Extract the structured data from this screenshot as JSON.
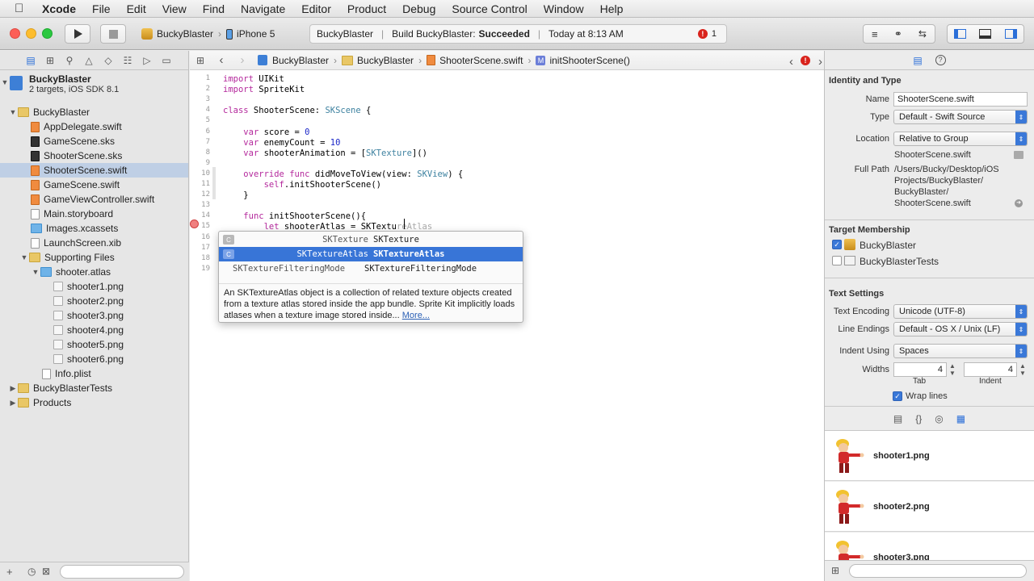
{
  "menubar": {
    "app": "Xcode",
    "items": [
      "File",
      "Edit",
      "View",
      "Find",
      "Navigate",
      "Editor",
      "Product",
      "Debug",
      "Source Control",
      "Window",
      "Help"
    ]
  },
  "toolbar": {
    "scheme": "BuckyBlaster",
    "device": "iPhone 5",
    "activity": {
      "project": "BuckyBlaster",
      "build_prefix": "Build BuckyBlaster:",
      "build_status": "Succeeded",
      "time": "Today at 8:13 AM",
      "error_count": "1"
    }
  },
  "navigator": {
    "project": {
      "name": "BuckyBlaster",
      "subtitle": "2 targets, iOS SDK 8.1"
    },
    "items": [
      {
        "label": "BuckyBlaster",
        "kind": "folder",
        "indent": 1,
        "open": true
      },
      {
        "label": "AppDelegate.swift",
        "kind": "swift",
        "indent": 2
      },
      {
        "label": "GameScene.sks",
        "kind": "sks",
        "indent": 2
      },
      {
        "label": "ShooterScene.sks",
        "kind": "sks",
        "indent": 2
      },
      {
        "label": "ShooterScene.swift",
        "kind": "swift",
        "indent": 2,
        "selected": true
      },
      {
        "label": "GameScene.swift",
        "kind": "swift",
        "indent": 2
      },
      {
        "label": "GameViewController.swift",
        "kind": "swift",
        "indent": 2
      },
      {
        "label": "Main.storyboard",
        "kind": "file",
        "indent": 2
      },
      {
        "label": "Images.xcassets",
        "kind": "bfolder",
        "indent": 2
      },
      {
        "label": "LaunchScreen.xib",
        "kind": "file",
        "indent": 2
      },
      {
        "label": "Supporting Files",
        "kind": "folder",
        "indent": 2,
        "open": true
      },
      {
        "label": "shooter.atlas",
        "kind": "bfolder",
        "indent": 3,
        "open": true
      },
      {
        "label": "shooter1.png",
        "kind": "png",
        "indent": 4
      },
      {
        "label": "shooter2.png",
        "kind": "png",
        "indent": 4
      },
      {
        "label": "shooter3.png",
        "kind": "png",
        "indent": 4
      },
      {
        "label": "shooter4.png",
        "kind": "png",
        "indent": 4
      },
      {
        "label": "shooter5.png",
        "kind": "png",
        "indent": 4
      },
      {
        "label": "shooter6.png",
        "kind": "png",
        "indent": 4
      },
      {
        "label": "Info.plist",
        "kind": "file",
        "indent": 3
      },
      {
        "label": "BuckyBlasterTests",
        "kind": "folder",
        "indent": 1,
        "open": false
      },
      {
        "label": "Products",
        "kind": "folder",
        "indent": 1,
        "open": false
      }
    ]
  },
  "jumpbar": [
    "BuckyBlaster",
    "BuckyBlaster",
    "ShooterScene.swift",
    "initShooterScene()"
  ],
  "code": {
    "line_numbers": [
      "1",
      "2",
      "3",
      "4",
      "5",
      "6",
      "7",
      "8",
      "9",
      "10",
      "11",
      "12",
      "13",
      "14",
      "15",
      "16",
      "17",
      "18",
      "19"
    ],
    "lines": [
      [
        {
          "t": "import",
          "c": "kw"
        },
        {
          "t": " UIKit"
        }
      ],
      [
        {
          "t": "import",
          "c": "kw"
        },
        {
          "t": " SpriteKit"
        }
      ],
      [],
      [
        {
          "t": "class",
          "c": "kw"
        },
        {
          "t": " ShooterScene: "
        },
        {
          "t": "SKScene",
          "c": "ty"
        },
        {
          "t": " {"
        }
      ],
      [],
      [
        {
          "t": "    "
        },
        {
          "t": "var",
          "c": "kw"
        },
        {
          "t": " score = "
        },
        {
          "t": "0",
          "c": "nu"
        }
      ],
      [
        {
          "t": "    "
        },
        {
          "t": "var",
          "c": "kw"
        },
        {
          "t": " enemyCount = "
        },
        {
          "t": "10",
          "c": "nu"
        }
      ],
      [
        {
          "t": "    "
        },
        {
          "t": "var",
          "c": "kw"
        },
        {
          "t": " shooterAnimation = ["
        },
        {
          "t": "SKTexture",
          "c": "ty"
        },
        {
          "t": "]()"
        }
      ],
      [],
      [
        {
          "t": "    "
        },
        {
          "t": "override",
          "c": "kw"
        },
        {
          "t": " "
        },
        {
          "t": "func",
          "c": "kw"
        },
        {
          "t": " didMoveToView(view: "
        },
        {
          "t": "SKView",
          "c": "ty"
        },
        {
          "t": ") {"
        }
      ],
      [
        {
          "t": "        "
        },
        {
          "t": "self",
          "c": "kw"
        },
        {
          "t": ".initShooterScene()"
        }
      ],
      [
        {
          "t": "    }"
        }
      ],
      [],
      [
        {
          "t": "    "
        },
        {
          "t": "func",
          "c": "kw"
        },
        {
          "t": " initShooterScene(){"
        }
      ],
      [
        {
          "t": "        "
        },
        {
          "t": "let",
          "c": "kw"
        },
        {
          "t": " shooterAtlas = SKTextu"
        },
        {
          "t": "reAtlas",
          "c": "ghost"
        }
      ],
      [],
      [],
      [],
      []
    ]
  },
  "autocomplete": {
    "suggestions": [
      {
        "type": "SKTexture",
        "name": "SKTexture",
        "kind": "C"
      },
      {
        "type": "SKTextureAtlas",
        "name": "SKTextureAtlas",
        "kind": "C",
        "active": true
      },
      {
        "type": "SKTextureFilteringMode",
        "name": "SKTextureFilteringMode",
        "kind": ""
      }
    ],
    "doc": "An SKTextureAtlas object is a collection of related texture objects created from a texture atlas stored inside the app bundle. Sprite Kit implicitly loads atlases when a texture image stored inside...",
    "more": "More..."
  },
  "inspector": {
    "identity": {
      "title": "Identity and Type",
      "name_label": "Name",
      "name": "ShooterScene.swift",
      "type_label": "Type",
      "type": "Default - Swift Source",
      "location_label": "Location",
      "location": "Relative to Group",
      "location_file": "ShooterScene.swift",
      "fullpath_label": "Full Path",
      "fullpath": [
        "/Users/Bucky/Desktop/iOS",
        "Projects/BuckyBlaster/",
        "BuckyBlaster/",
        "ShooterScene.swift"
      ]
    },
    "membership": {
      "title": "Target Membership",
      "targets": [
        {
          "name": "BuckyBlaster",
          "checked": true
        },
        {
          "name": "BuckyBlasterTests",
          "checked": false
        }
      ]
    },
    "text": {
      "title": "Text Settings",
      "encoding_label": "Text Encoding",
      "encoding": "Unicode (UTF-8)",
      "endings_label": "Line Endings",
      "endings": "Default - OS X / Unix (LF)",
      "indent_label": "Indent Using",
      "indent": "Spaces",
      "widths_label": "Widths",
      "tab_width": "4",
      "indent_width": "4",
      "tab_label": "Tab",
      "indent_sub_label": "Indent",
      "wrap_label": "Wrap lines"
    },
    "library": [
      "shooter1.png",
      "shooter2.png",
      "shooter3.png"
    ]
  },
  "colors": {
    "accent": "#3875d7",
    "selection": "#bfcfe5",
    "error": "#d9231c"
  }
}
